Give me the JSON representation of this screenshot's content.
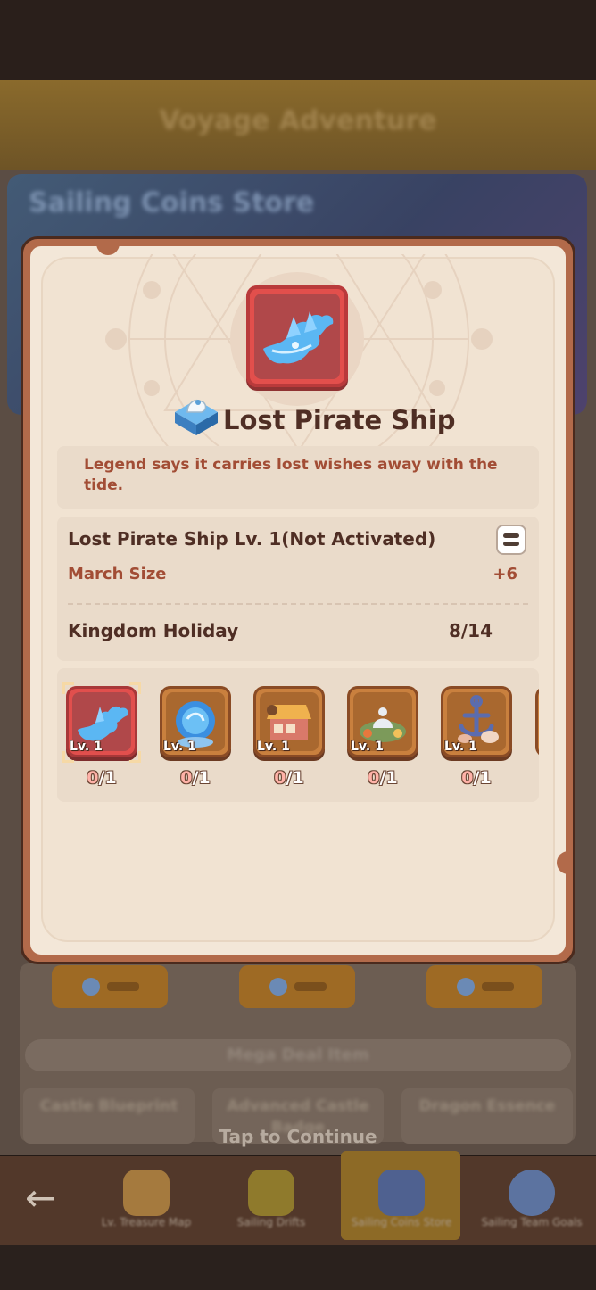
{
  "background": {
    "header_title": "Voyage Adventure",
    "store_title": "Sailing Coins Store",
    "strip_label": "Mega Deal Item",
    "cards": [
      "Castle Blueprint",
      "Advanced Castle Badge",
      "Dragon Essence"
    ],
    "nav_items": [
      {
        "label": "Lv. Treasure Map",
        "icon": "treasure-map-icon"
      },
      {
        "label": "Sailing Drifts",
        "icon": "drift-icon"
      },
      {
        "label": "Sailing Coins Store",
        "icon": "chest-icon"
      },
      {
        "label": "Sailing Team Goals",
        "icon": "team-icon"
      }
    ]
  },
  "modal": {
    "item_name": "Lost Pirate Ship",
    "description": "Legend says it carries lost wishes away with the tide.",
    "status_line": "Lost Pirate Ship Lv. 1(Not Activated)",
    "stat": {
      "name": "March Size",
      "value": "+6"
    },
    "set": {
      "name": "Kingdom Holiday",
      "progress": "8/14"
    },
    "items": [
      {
        "level": "Lv. 1",
        "owned": "0",
        "required": "/1",
        "icon": "ghost-ship-icon",
        "selected": true
      },
      {
        "level": "Lv. 1",
        "owned": "0",
        "required": "/1",
        "icon": "crystal-orb-icon",
        "selected": false
      },
      {
        "level": "Lv. 1",
        "owned": "0",
        "required": "/1",
        "icon": "market-stall-icon",
        "selected": false
      },
      {
        "level": "Lv. 1",
        "owned": "0",
        "required": "/1",
        "icon": "teapot-feast-icon",
        "selected": false
      },
      {
        "level": "Lv. 1",
        "owned": "0",
        "required": "/1",
        "icon": "anchor-shells-icon",
        "selected": false
      }
    ]
  },
  "footer_hint": "Tap to Continue",
  "colors": {
    "accent_red": "#e24f4c",
    "text_brown": "#4f2e24",
    "text_rust": "#a24d35",
    "frame_orange": "#c9803e"
  }
}
